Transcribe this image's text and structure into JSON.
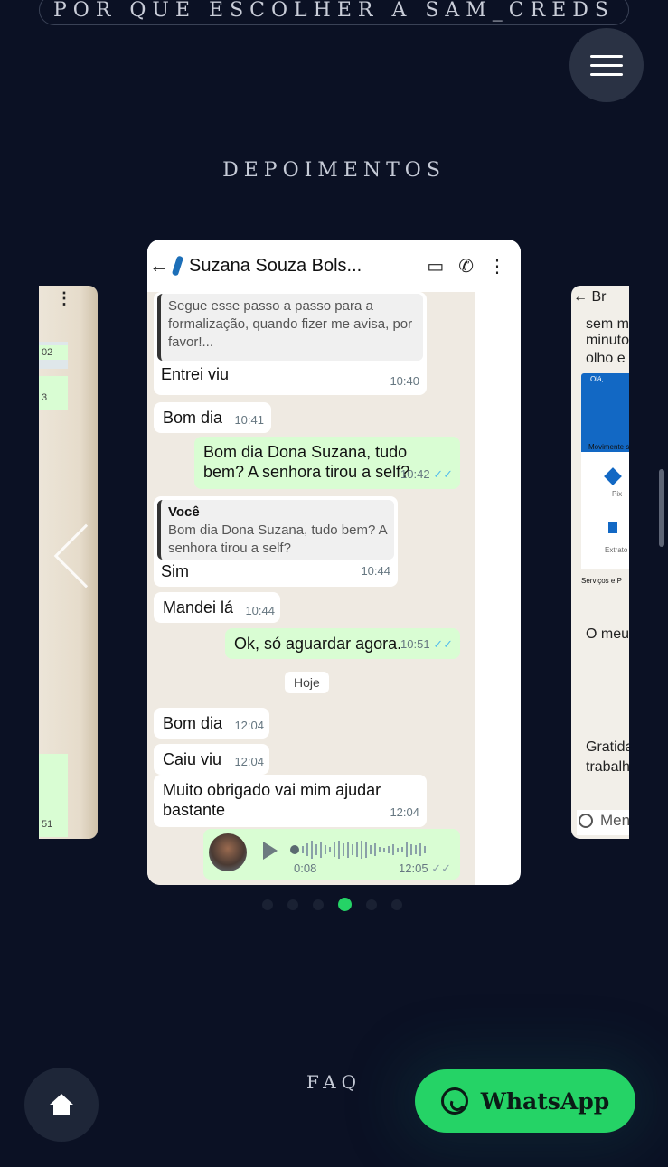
{
  "nav": {
    "top_pill_label": "POR QUE ESCOLHER A SAM_CREDS",
    "menu_icon": "hamburger-icon"
  },
  "section": {
    "title": "DEPOIMENTOS",
    "faq_label": "FAQ"
  },
  "carousel": {
    "dot_count": 6,
    "active_dot": 4,
    "side_left": {
      "bubble_times": [
        "02",
        "3",
        "51"
      ]
    },
    "side_right": {
      "header_fragment": "Br",
      "text_lines": [
        "sem m",
        "minuto",
        "olho e t"
      ],
      "phone_labels": [
        "Olá,",
        "Movimente s",
        "Pix",
        "Extrato",
        "Serviços e P"
      ],
      "text_after": "O meu",
      "text_bottom": [
        "Gratida",
        "trabalh"
      ],
      "input_placeholder": "Men"
    }
  },
  "chat": {
    "contact_name": "Suzana Souza Bols...",
    "messages": [
      {
        "kind": "in",
        "quote": "Segue esse passo a passo para a formalização, quando fizer me avisa, por favor!...",
        "text": "Entrei viu",
        "time": "10:40"
      },
      {
        "kind": "in",
        "text": "Bom dia",
        "time": "10:41"
      },
      {
        "kind": "out",
        "text": "Bom dia Dona Suzana, tudo bem? A senhora tirou a self?",
        "time": "10:42"
      },
      {
        "kind": "in",
        "quote_author": "Você",
        "quote": "Bom dia Dona Suzana, tudo bem? A senhora tirou a self?",
        "text": "Sim",
        "time": "10:44"
      },
      {
        "kind": "in",
        "text": "Mandei lá",
        "time": "10:44"
      },
      {
        "kind": "out",
        "text": "Ok, só aguardar agora.",
        "time": "10:51"
      },
      {
        "kind": "day",
        "text": "Hoje"
      },
      {
        "kind": "in",
        "text": "Bom dia",
        "time": "12:04"
      },
      {
        "kind": "in",
        "text": "Caiu viu",
        "time": "12:04"
      },
      {
        "kind": "in",
        "text": "Muito obrigado vai mim ajudar bastante",
        "time": "12:04"
      }
    ],
    "audio": {
      "duration": "0:08",
      "time": "12:05"
    }
  },
  "footer": {
    "whatsapp_label": "WhatsApp",
    "home_icon": "home-icon",
    "whatsapp_icon": "whatsapp-icon"
  },
  "colors": {
    "background": "#0b1124",
    "whatsapp_green": "#25d366",
    "bubble_out": "#d9fdd3"
  }
}
